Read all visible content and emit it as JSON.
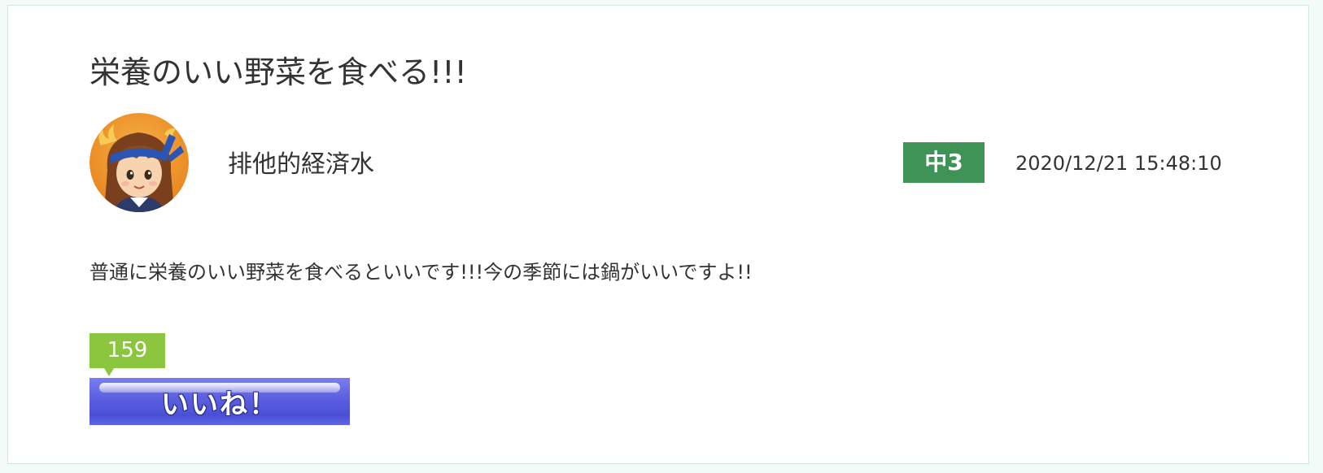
{
  "post": {
    "title": "栄養のいい野菜を食べる!!!",
    "author": "排他的経済水",
    "grade_badge": "中3",
    "timestamp": "2020/12/21 15:48:10",
    "body": "普通に栄養のいい野菜を食べるといいです!!!今の季節には鍋がいいですよ!!"
  },
  "like": {
    "count": "159",
    "button_label": "いいね！"
  },
  "avatar": {
    "icon": "user-avatar-icon"
  },
  "colors": {
    "page_background": "#f2fbf7",
    "card_border": "#cfe7dc",
    "grade_badge": "#3f9356",
    "like_count_bubble": "#8cc63f",
    "like_button": "#5a5fe0",
    "avatar_background": "#f0932b",
    "headband": "#2b55b5"
  }
}
